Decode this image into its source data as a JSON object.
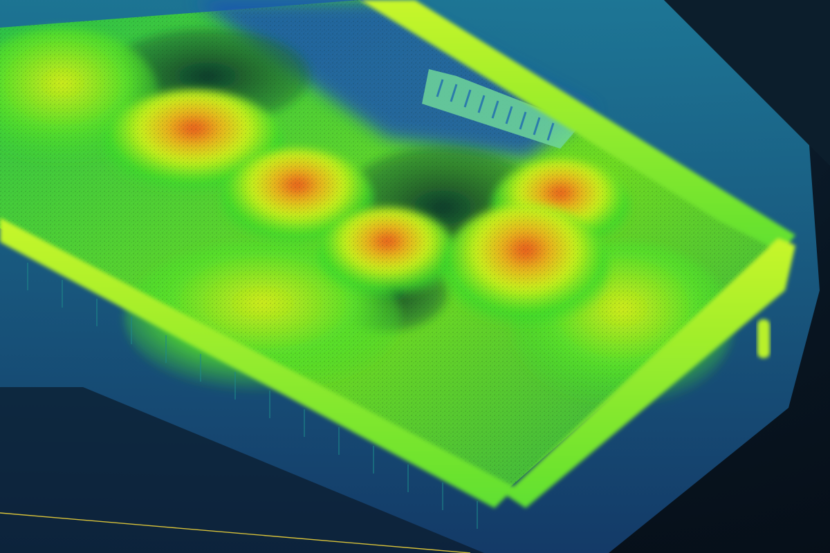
{
  "viewer": {
    "background_color": "#060d16",
    "ground_line_color": "#d8c23a"
  },
  "scene": {
    "subject": "point-cloud-stockpile-building",
    "color_ramp": {
      "low": "#1d5fa8",
      "mid_low": "#1fa0a0",
      "mid": "#3bdc2a",
      "mid_high": "#c8f21a",
      "high": "#e9b41e",
      "peak": "#e8521d"
    },
    "stockpile_count": 7,
    "has_perimeter_wall": true,
    "has_conveyor_structure": true,
    "has_small_pillar": true
  }
}
